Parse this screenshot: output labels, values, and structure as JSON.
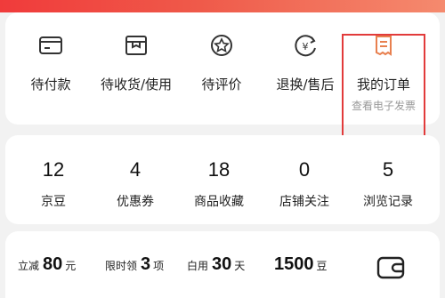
{
  "colors": {
    "accent": "#e23b3b",
    "text": "#222222",
    "muted": "#999999",
    "icon": "#333333"
  },
  "orders": {
    "items": [
      {
        "label": "待付款",
        "icon": "wallet-card-icon"
      },
      {
        "label": "待收货/使用",
        "icon": "package-box-icon"
      },
      {
        "label": "待评价",
        "icon": "star-badge-icon"
      },
      {
        "label": "退换/售后",
        "icon": "yen-refund-icon"
      },
      {
        "label": "我的订单",
        "sub": "查看电子发票",
        "icon": "receipt-icon"
      }
    ]
  },
  "stats": [
    {
      "value": "12",
      "label": "京豆"
    },
    {
      "value": "4",
      "label": "优惠券"
    },
    {
      "value": "18",
      "label": "商品收藏"
    },
    {
      "value": "0",
      "label": "店铺关注"
    },
    {
      "value": "5",
      "label": "浏览记录"
    }
  ],
  "promo": [
    {
      "pre": "立减",
      "value": "80",
      "unit": "元"
    },
    {
      "pre": "限时领",
      "value": "3",
      "unit": "项"
    },
    {
      "pre": "白用",
      "value": "30",
      "unit": "天"
    },
    {
      "pre": "",
      "value": "1500",
      "unit": "豆"
    }
  ],
  "promo_wallet_icon": "wallet-icon"
}
